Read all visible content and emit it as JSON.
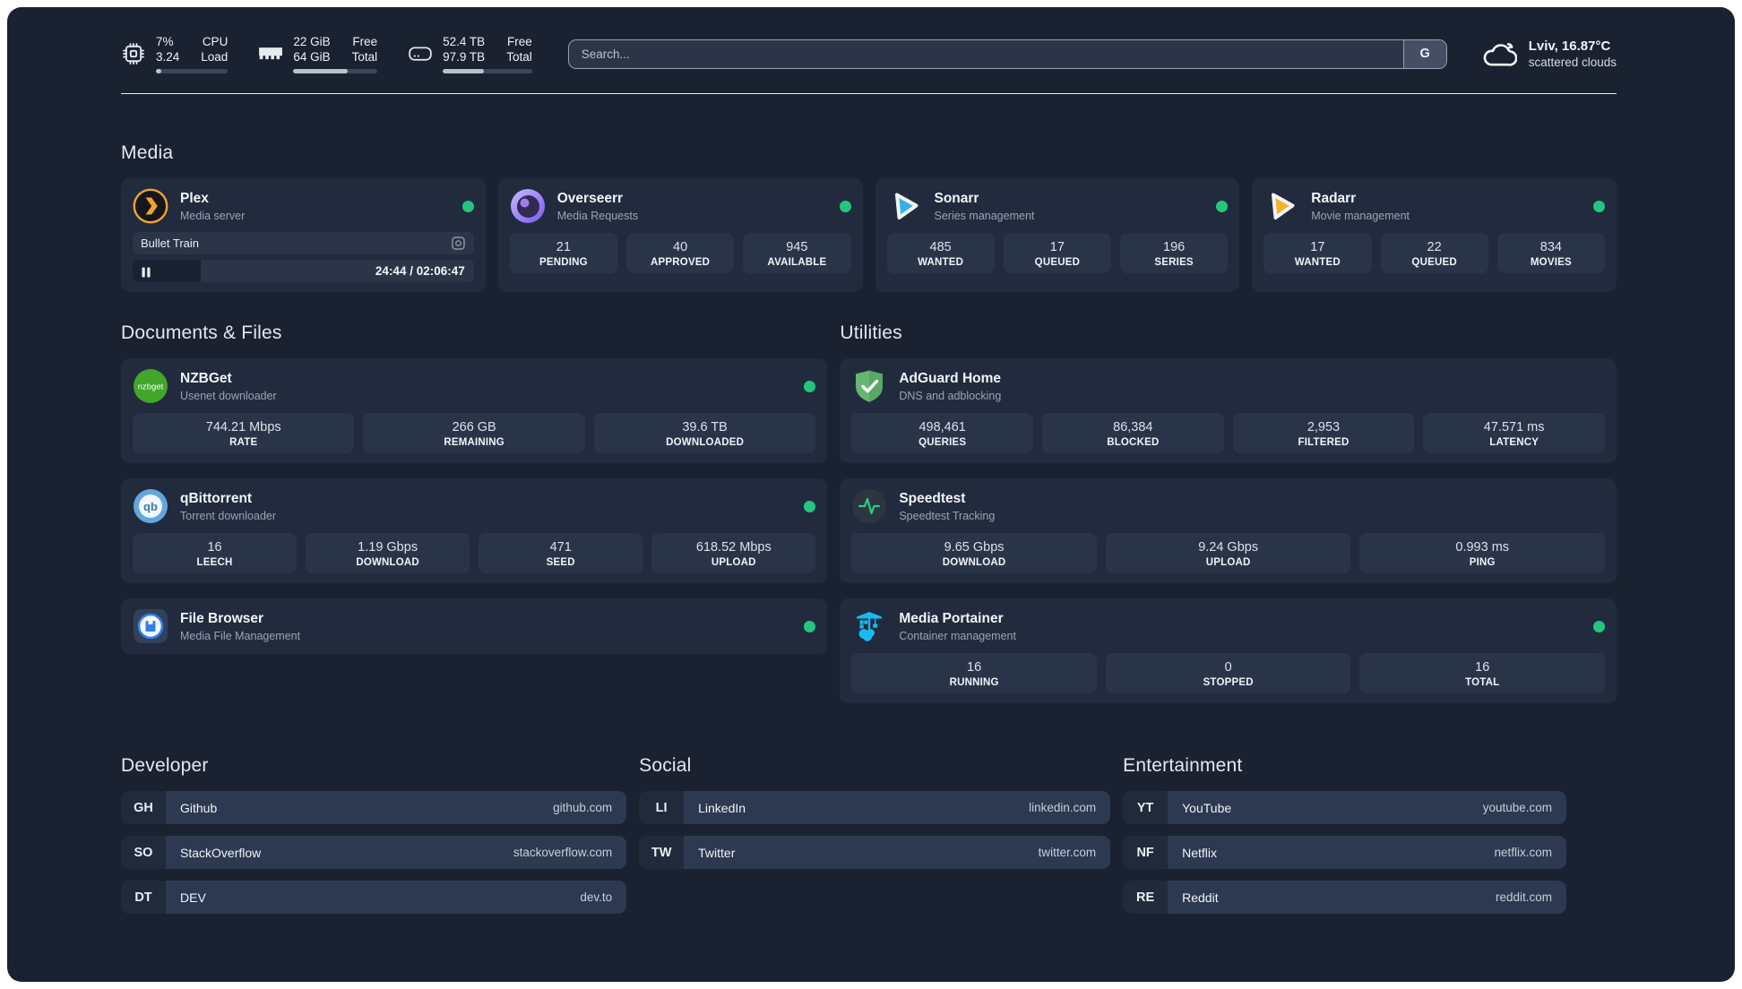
{
  "colors": {
    "status_online": "#22c77f",
    "portainer_blue": "#19b9f2",
    "plex_amber": "#f0a32e"
  },
  "header": {
    "stats": [
      {
        "icon": "cpu-icon",
        "value_top": "7%",
        "value_bottom": "3.24",
        "label_top": "CPU",
        "label_bottom": "Load",
        "progress_pct": 8
      },
      {
        "icon": "ram-icon",
        "value_top": "22 GiB",
        "value_bottom": "64 GiB",
        "label_top": "Free",
        "label_bottom": "Total",
        "progress_pct": 65
      },
      {
        "icon": "disk-icon",
        "value_top": "52.4 TB",
        "value_bottom": "97.9 TB",
        "label_top": "Free",
        "label_bottom": "Total",
        "progress_pct": 46
      }
    ],
    "search": {
      "placeholder": "Search...",
      "engine_label": "G"
    },
    "weather": {
      "location": "Lviv, 16.87°C",
      "condition": "scattered clouds"
    }
  },
  "media": {
    "title": "Media",
    "apps": [
      {
        "name": "Plex",
        "subtitle": "Media server",
        "now_playing": {
          "title": "Bullet Train",
          "time": "24:44 / 02:06:47",
          "progress_pct": 20
        }
      },
      {
        "name": "Overseerr",
        "subtitle": "Media Requests",
        "stats": [
          {
            "value": "21",
            "label": "PENDING"
          },
          {
            "value": "40",
            "label": "APPROVED"
          },
          {
            "value": "945",
            "label": "AVAILABLE"
          }
        ]
      },
      {
        "name": "Sonarr",
        "subtitle": "Series management",
        "stats": [
          {
            "value": "485",
            "label": "WANTED"
          },
          {
            "value": "17",
            "label": "QUEUED"
          },
          {
            "value": "196",
            "label": "SERIES"
          }
        ]
      },
      {
        "name": "Radarr",
        "subtitle": "Movie management",
        "stats": [
          {
            "value": "17",
            "label": "WANTED"
          },
          {
            "value": "22",
            "label": "QUEUED"
          },
          {
            "value": "834",
            "label": "MOVIES"
          }
        ]
      }
    ]
  },
  "documents": {
    "title": "Documents & Files",
    "apps": [
      {
        "name": "NZBGet",
        "subtitle": "Usenet downloader",
        "stats": [
          {
            "value": "744.21 Mbps",
            "label": "RATE"
          },
          {
            "value": "266 GB",
            "label": "REMAINING"
          },
          {
            "value": "39.6 TB",
            "label": "DOWNLOADED"
          }
        ]
      },
      {
        "name": "qBittorrent",
        "subtitle": "Torrent downloader",
        "stats": [
          {
            "value": "16",
            "label": "LEECH"
          },
          {
            "value": "1.19 Gbps",
            "label": "DOWNLOAD"
          },
          {
            "value": "471",
            "label": "SEED"
          },
          {
            "value": "618.52 Mbps",
            "label": "UPLOAD"
          }
        ]
      },
      {
        "name": "File Browser",
        "subtitle": "Media File Management"
      }
    ]
  },
  "utilities": {
    "title": "Utilities",
    "apps": [
      {
        "name": "AdGuard Home",
        "subtitle": "DNS and adblocking",
        "stats": [
          {
            "value": "498,461",
            "label": "QUERIES"
          },
          {
            "value": "86,384",
            "label": "BLOCKED"
          },
          {
            "value": "2,953",
            "label": "FILTERED"
          },
          {
            "value": "47.571 ms",
            "label": "LATENCY"
          }
        ]
      },
      {
        "name": "Speedtest",
        "subtitle": "Speedtest Tracking",
        "stats": [
          {
            "value": "9.65 Gbps",
            "label": "DOWNLOAD"
          },
          {
            "value": "9.24 Gbps",
            "label": "UPLOAD"
          },
          {
            "value": "0.993 ms",
            "label": "PING"
          }
        ]
      },
      {
        "name": "Media Portainer",
        "subtitle": "Container management",
        "stats": [
          {
            "value": "16",
            "label": "RUNNING"
          },
          {
            "value": "0",
            "label": "STOPPED"
          },
          {
            "value": "16",
            "label": "TOTAL"
          }
        ]
      }
    ]
  },
  "bookmarks": [
    {
      "title": "Developer",
      "links": [
        {
          "abbr": "GH",
          "name": "Github",
          "url": "github.com"
        },
        {
          "abbr": "SO",
          "name": "StackOverflow",
          "url": "stackoverflow.com"
        },
        {
          "abbr": "DT",
          "name": "DEV",
          "url": "dev.to"
        }
      ]
    },
    {
      "title": "Social",
      "links": [
        {
          "abbr": "LI",
          "name": "LinkedIn",
          "url": "linkedin.com"
        },
        {
          "abbr": "TW",
          "name": "Twitter",
          "url": "twitter.com"
        }
      ]
    },
    {
      "title": "Entertainment",
      "links": [
        {
          "abbr": "YT",
          "name": "YouTube",
          "url": "youtube.com"
        },
        {
          "abbr": "NF",
          "name": "Netflix",
          "url": "netflix.com"
        },
        {
          "abbr": "RE",
          "name": "Reddit",
          "url": "reddit.com"
        }
      ]
    }
  ]
}
